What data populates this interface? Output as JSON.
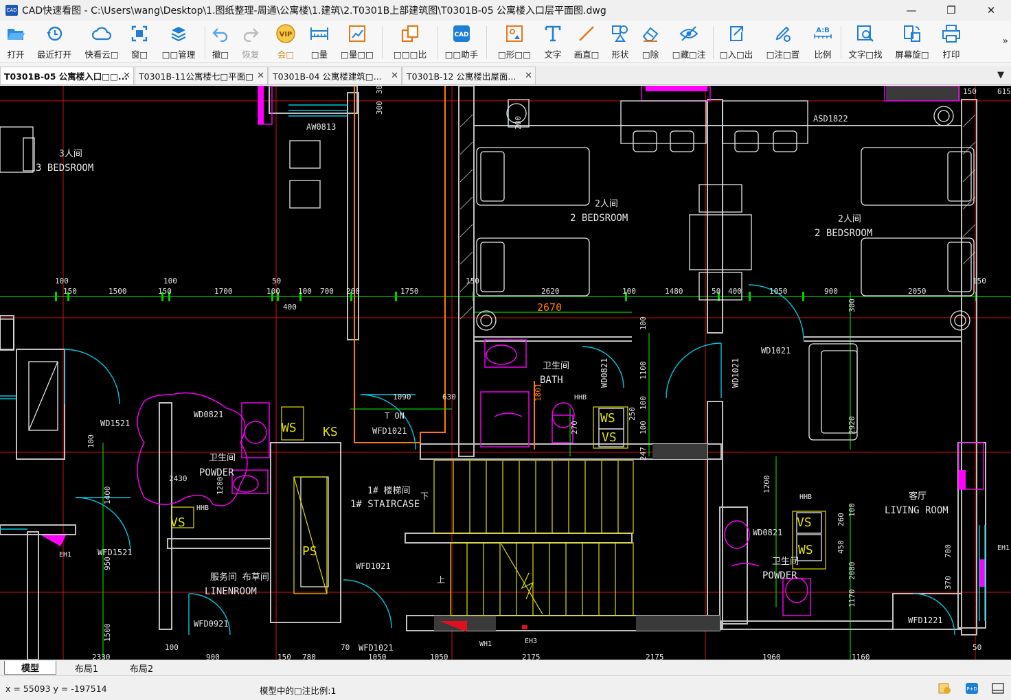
{
  "window": {
    "title": "CAD快速看图 - C:\\Users\\wang\\Desktop\\1.图纸整理-周通\\公寓楼\\1.建筑\\2.T0301B上部建筑图\\T0301B-05 公寓楼入口层平面图.dwg",
    "logo_text": "CAD",
    "minimize": "—",
    "maximize": "❐",
    "close": "✕"
  },
  "toolbar": {
    "items": [
      {
        "label": "打开",
        "icon": "folder-open-icon"
      },
      {
        "label": "最近打开",
        "icon": "recent-clock-icon"
      },
      {
        "label": "快看云□",
        "icon": "cloud-icon"
      },
      {
        "label": "窗□",
        "icon": "window-zoom-icon"
      },
      {
        "label": "□□管理",
        "icon": "layers-icon"
      },
      {
        "label": "撤□",
        "icon": "undo-icon"
      },
      {
        "label": "恢复",
        "icon": "redo-icon"
      },
      {
        "label": "会□",
        "icon": "vip-icon"
      },
      {
        "label": "□量",
        "icon": "measure-ruler-icon"
      },
      {
        "label": "□量□□",
        "icon": "measure-stats-icon"
      },
      {
        "label": "□□□比",
        "icon": "compare-icon"
      },
      {
        "label": "□□助手",
        "icon": "cad-assistant-icon"
      },
      {
        "label": "□形□□",
        "icon": "shape-frame-icon"
      },
      {
        "label": "文字",
        "icon": "text-t-icon"
      },
      {
        "label": "画直□",
        "icon": "line-draw-icon"
      },
      {
        "label": "形状",
        "icon": "shapes-icon"
      },
      {
        "label": "□除",
        "icon": "eraser-icon"
      },
      {
        "label": "□藏□注",
        "icon": "hide-eye-icon"
      },
      {
        "label": "□入□出",
        "icon": "export-icon"
      },
      {
        "label": "□注□置",
        "icon": "annotation-settings-icon"
      },
      {
        "label": "比例",
        "icon": "scale-ab-icon"
      },
      {
        "label": "文字□找",
        "icon": "text-search-icon"
      },
      {
        "label": "屏幕旋□",
        "icon": "rotate-screen-icon"
      },
      {
        "label": "打印",
        "icon": "printer-icon"
      }
    ],
    "more": "»"
  },
  "tabs": [
    {
      "label": "T0301B-05 公寓楼入口□□..."
    },
    {
      "label": "T0301B-11公寓楼七□平面□"
    },
    {
      "label": "T0301B-04 公寓楼建筑□..."
    },
    {
      "label": "T0301B-12 公寓楼出屋面..."
    }
  ],
  "tab_close": "✕",
  "tab_menu": "▼",
  "drawing": {
    "room_labels": [
      {
        "cn": "3人间",
        "en": "3 BEDSROOM"
      },
      {
        "cn": "2人间",
        "en": "2 BEDSROOM"
      },
      {
        "cn": "2人间",
        "en": "2 BEDSROOM"
      },
      {
        "cn": "卫生间",
        "en": "BATH"
      },
      {
        "cn": "卫生间",
        "en": "POWDER"
      },
      {
        "cn": "1# 楼梯间",
        "en": "1# STAIRCASE"
      },
      {
        "cn": "服务间 布草间",
        "en": "LINENROOM"
      },
      {
        "cn": "客厅",
        "en": "LIVING ROOM"
      },
      {
        "cn": "卫生间",
        "en": "POWDER"
      }
    ],
    "tags": [
      "AW0813",
      "ASD1822",
      "WD1521",
      "WD0821",
      "WFD1021",
      "WFD1521",
      "WFD0921",
      "WD1021",
      "WD1021",
      "WD0821",
      "WFD1221",
      "WD0821",
      "WFD1021",
      "WFD1021",
      "HHB",
      "HHB",
      "HHB",
      "EH1",
      "EH1",
      "WH1",
      "EH3",
      "PS",
      "KS",
      "WS",
      "WS",
      "WS",
      "VS",
      "VS",
      "VS",
      "上",
      "下",
      "T ON"
    ],
    "dimension_row": [
      "100",
      "150",
      "1500",
      "100",
      "150",
      "1700",
      "50",
      "100",
      "100",
      "700",
      "200",
      "400",
      "1750",
      "150",
      "2620",
      "100",
      "1480",
      "50",
      "400",
      "1050",
      "900",
      "2050",
      "150"
    ],
    "dims_misc": [
      "2670",
      "300",
      "300",
      "200",
      "1090",
      "630",
      "1801",
      "100",
      "1100",
      "100",
      "100",
      "2920",
      "300",
      "1200",
      "260",
      "100",
      "450",
      "2080",
      "1170",
      "700",
      "370",
      "100",
      "1400",
      "950",
      "1500",
      "2430",
      "1200",
      "270",
      "250",
      "247",
      "615",
      "150"
    ],
    "bottom_dims": [
      "2330",
      "100",
      "900",
      "150",
      "780",
      "70",
      "1050",
      "1050",
      "2175",
      "2175",
      "1960",
      "1160",
      "50"
    ]
  },
  "layout_tabs": [
    {
      "label": "模型"
    },
    {
      "label": "布局1"
    },
    {
      "label": "布局2"
    }
  ],
  "status": {
    "coords": "x = 55093 y = -197514",
    "scale_text": "模型中的□注比例:1",
    "icons": [
      "coin-icon",
      "pdf-icon",
      "panel-icon"
    ]
  },
  "colors": {
    "canvas_bg": "#000000",
    "wall": "#c0c0c0",
    "axis_red": "#d01010",
    "dim_green": "#00d000",
    "door_cyan": "#00c8e0",
    "furniture_white": "#e6e6e6",
    "magenta": "#ff00ff",
    "yellow": "#e0e000",
    "orange": "#ff7a00",
    "toolbar_blue": "#1f7fd6"
  }
}
